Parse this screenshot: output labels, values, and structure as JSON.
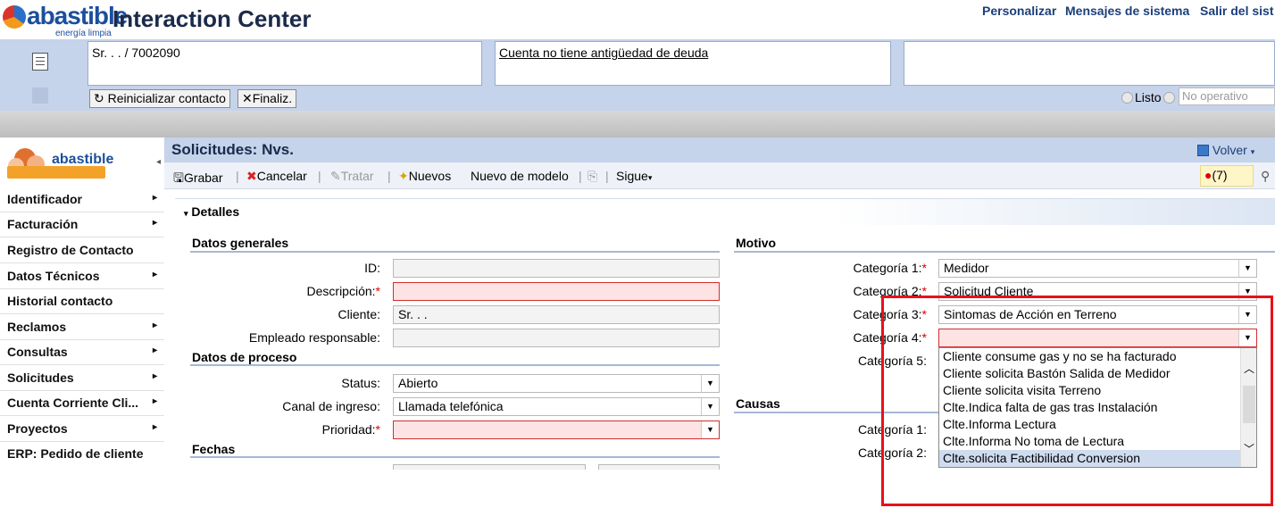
{
  "header": {
    "logo_text": "abastible",
    "logo_sub": "energía limpia",
    "app_title": "Interaction Center",
    "links": [
      "Personalizar",
      "Mensajes de sistema",
      "Salir del sist"
    ]
  },
  "context": {
    "customer": "Sr. . . / 7002090",
    "debt_note": "Cuenta no tiene antigüedad de deuda",
    "reset_button": "Reinicializar contacto",
    "finish_button": "Finaliz.",
    "status_listo": "Listo",
    "status_no_operativo": "No operativo"
  },
  "sidebar": {
    "logo_text": "abastible",
    "items": [
      {
        "label": "Identificador",
        "arrow": "▸"
      },
      {
        "label": "Facturación",
        "arrow": "▸"
      },
      {
        "label": "Registro de Contacto",
        "arrow": ""
      },
      {
        "label": "Datos Técnicos",
        "arrow": "▸"
      },
      {
        "label": "Historial contacto",
        "arrow": ""
      },
      {
        "label": "Reclamos",
        "arrow": "▸"
      },
      {
        "label": "Consultas",
        "arrow": "▸"
      },
      {
        "label": "Solicitudes",
        "arrow": "▸"
      },
      {
        "label": "Cuenta Corriente Cli...",
        "arrow": "▸"
      },
      {
        "label": "Proyectos",
        "arrow": "▸"
      },
      {
        "label": "ERP: Pedido de cliente",
        "arrow": ""
      }
    ]
  },
  "main": {
    "title": "Solicitudes: Nvs.",
    "volver": "Volver",
    "toolbar": {
      "grabar": "Grabar",
      "cancelar": "Cancelar",
      "tratar": "Tratar",
      "nuevos": "Nuevos",
      "nuevo_modelo": "Nuevo de modelo",
      "sigue": "Sigue"
    },
    "alerts_count": "(7)",
    "detalles": "Detalles",
    "general": {
      "title": "Datos generales",
      "id_label": "ID:",
      "desc_label": "Descripción:",
      "cliente_label": "Cliente:",
      "cliente_value": "Sr. . .",
      "empleado_label": "Empleado responsable:"
    },
    "proceso": {
      "title": "Datos de proceso",
      "status_label": "Status:",
      "status_value": "Abierto",
      "canal_label": "Canal de ingreso:",
      "canal_value": "Llamada telefónica",
      "prioridad_label": "Prioridad:"
    },
    "fechas": {
      "title": "Fechas"
    },
    "motivo": {
      "title": "Motivo",
      "cat1_label": "Categoría 1:",
      "cat1_value": "Medidor",
      "cat2_label": "Categoría 2:",
      "cat2_value": "Solicitud Cliente",
      "cat3_label": "Categoría 3:",
      "cat3_value": "Sintomas de Acción en Terreno",
      "cat4_label": "Categoría 4:",
      "cat5_label": "Categoría 5:"
    },
    "causas": {
      "title": "Causas",
      "cat1_label": "Categoría 1:",
      "cat2_label": "Categoría 2:"
    },
    "dropdown_options": [
      "Cliente consume gas y no se ha facturado",
      "Cliente solicita Bastón Salida de Medidor",
      "Cliente solicita visita Terreno",
      "Clte.Indica falta de gas tras Instalación",
      "Clte.Informa Lectura",
      "Clte.Informa No toma de Lectura",
      "Clte.solicita Factibilidad Conversion"
    ]
  },
  "colors": {
    "highlight_box": "#e8111a",
    "context_bar": "#c5d3eb",
    "required_field": "#fde3e3"
  }
}
